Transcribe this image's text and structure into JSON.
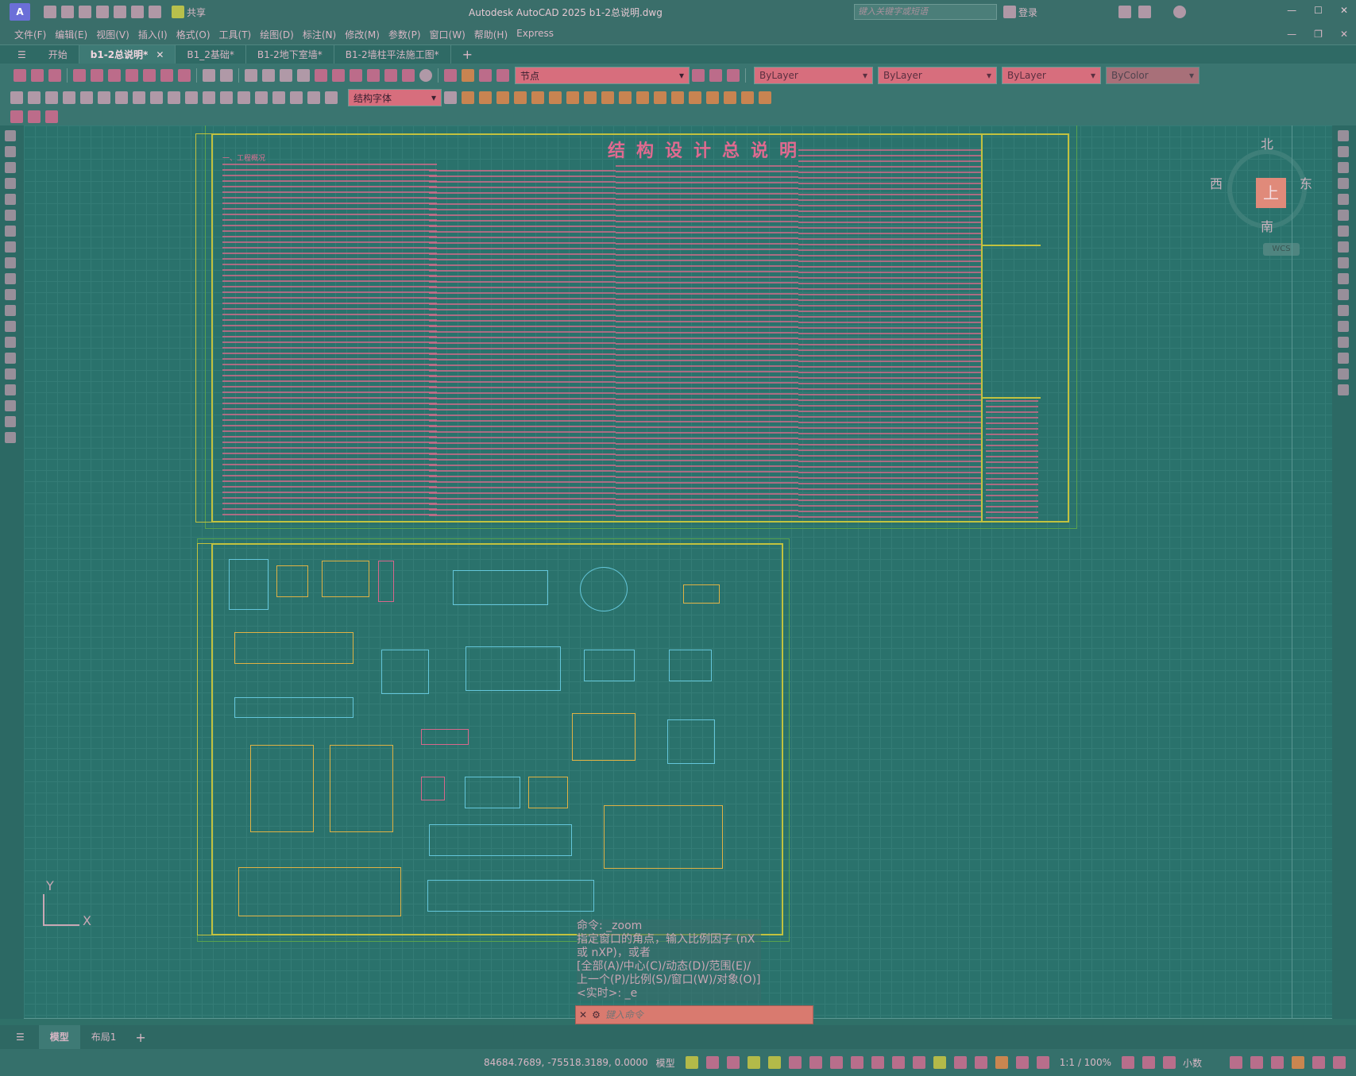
{
  "app": {
    "logo_letter": "A",
    "title": "Autodesk AutoCAD 2025    b1-2总说明.dwg",
    "share_label": "共享",
    "search_placeholder": "键入关键字或短语",
    "login_label": "登录"
  },
  "menu": [
    "文件(F)",
    "编辑(E)",
    "视图(V)",
    "插入(I)",
    "格式(O)",
    "工具(T)",
    "绘图(D)",
    "标注(N)",
    "修改(M)",
    "参数(P)",
    "窗口(W)",
    "帮助(H)",
    "Express"
  ],
  "tabs": [
    {
      "label": "开始",
      "active": false
    },
    {
      "label": "b1-2总说明*",
      "active": true
    },
    {
      "label": "B1_2基础*",
      "active": false
    },
    {
      "label": "B1-2地下室墙*",
      "active": false
    },
    {
      "label": "B1-2墙柱平法施工图*",
      "active": false
    }
  ],
  "toolbar": {
    "layer_name": "节点",
    "color_prop": "ByLayer",
    "linetype_prop": "ByLayer",
    "lineweight_prop": "ByLayer",
    "plot_style": "ByColor",
    "text_style": "结构字体"
  },
  "drawing": {
    "title": "结构设计总说明",
    "section_label": "一、工程概况"
  },
  "viewcube": {
    "north": "北",
    "south": "南",
    "east": "东",
    "west": "西",
    "top": "上",
    "wcs": "WCS"
  },
  "ucs": {
    "y": "Y",
    "x": "X"
  },
  "command": {
    "history": [
      "命令: _zoom",
      "指定窗口的角点，输入比例因子 (nX 或 nXP)，或者",
      "[全部(A)/中心(C)/动态(D)/范围(E)/上一个(P)/比例(S)/窗口(W)/对象(O)] <实时>: _e"
    ],
    "placeholder": "键入命令"
  },
  "layouts": [
    {
      "label": "模型",
      "active": true
    },
    {
      "label": "布局1",
      "active": false
    }
  ],
  "status": {
    "coordinates": "84684.7689, -75518.3189, 0.0000",
    "model_label": "模型",
    "scale": "1:1 / 100%",
    "units": "小数"
  },
  "colors": {
    "background": "#2f7068",
    "canvas": "#2a726c",
    "frame": "#c2c23f",
    "accent": "#d76e7d"
  }
}
